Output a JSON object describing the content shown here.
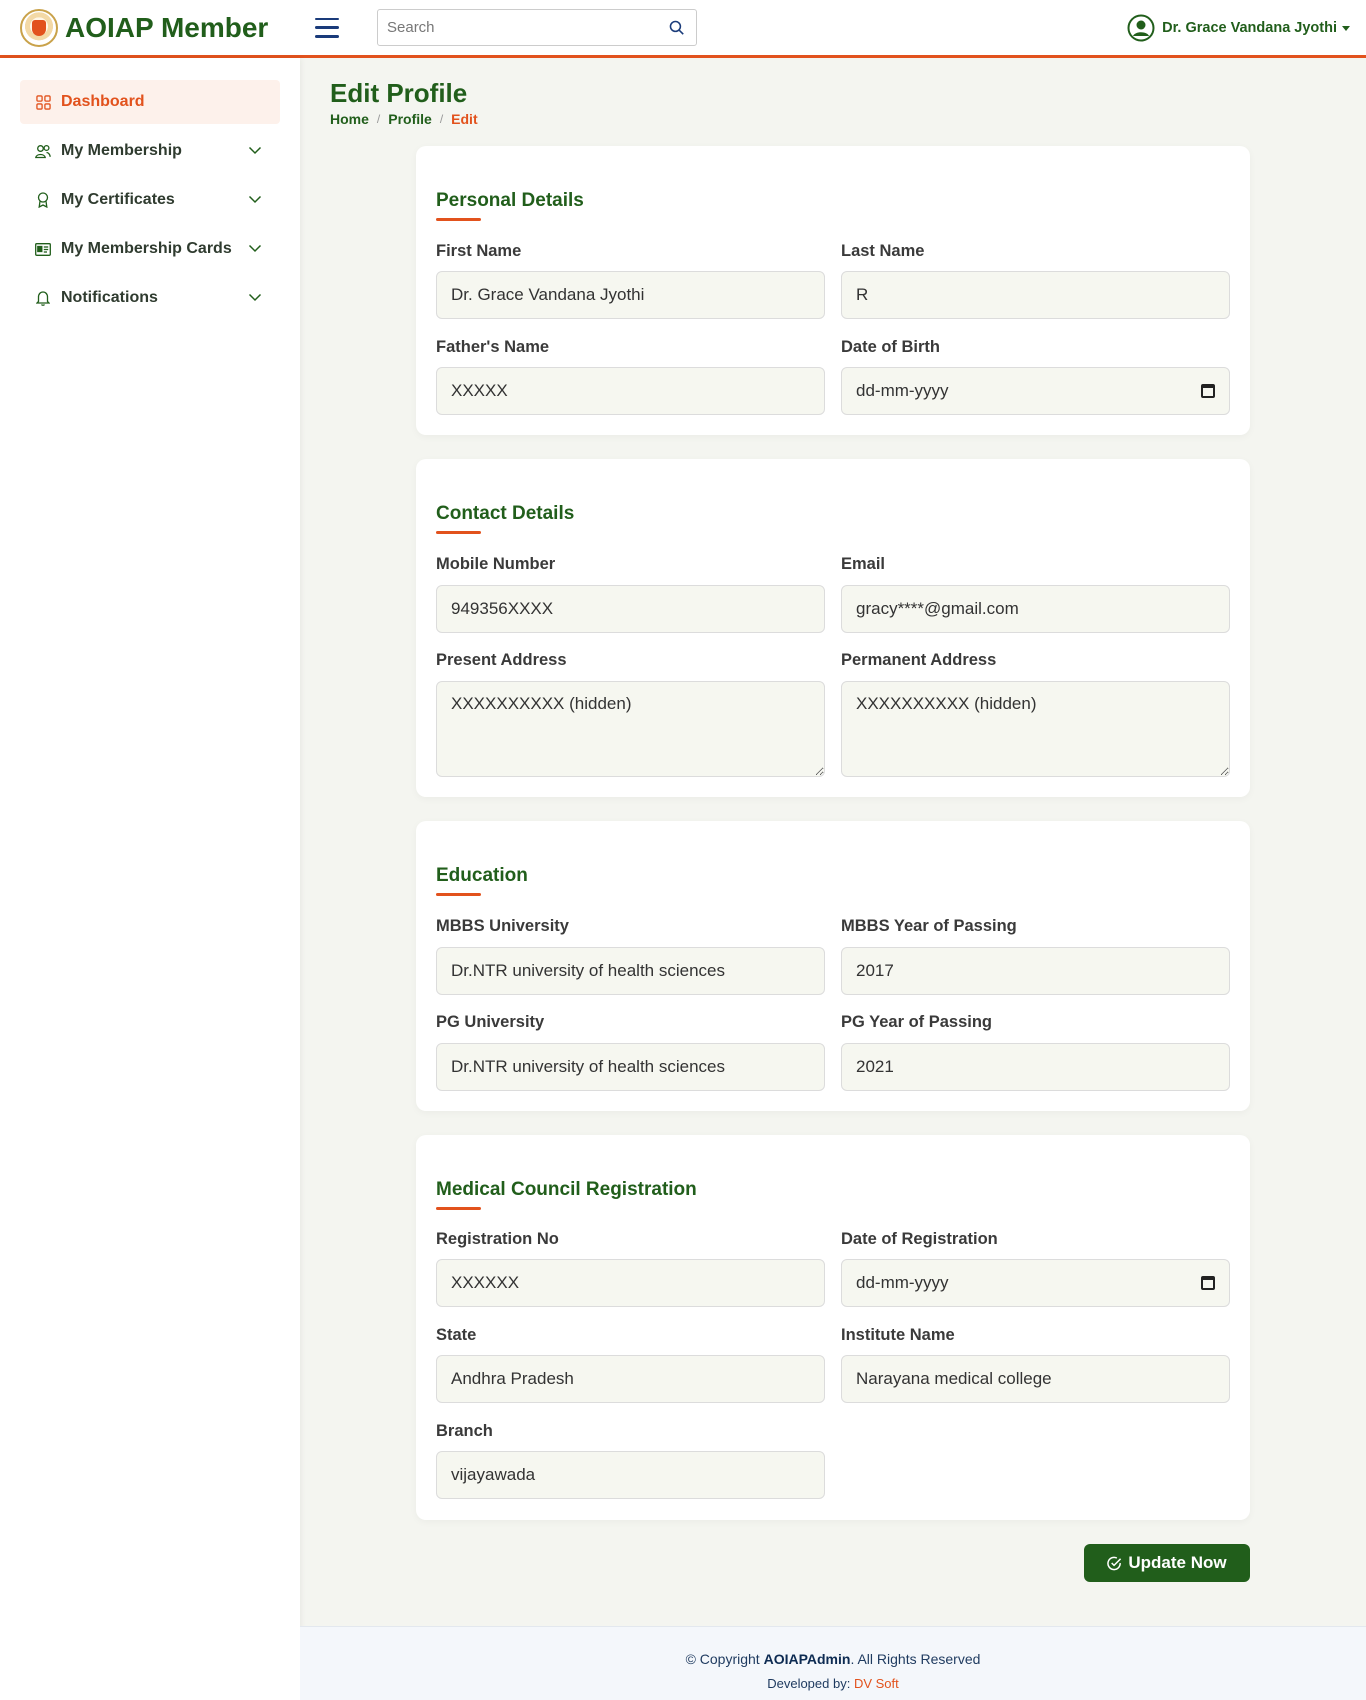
{
  "app": {
    "title": "AOIAP Member"
  },
  "search": {
    "placeholder": "Search"
  },
  "user": {
    "name": "Dr. Grace Vandana Jyothi"
  },
  "sidebar": {
    "items": [
      {
        "label": "Dashboard",
        "icon": "grid-icon",
        "active": true
      },
      {
        "label": "My Membership",
        "icon": "users-icon"
      },
      {
        "label": "My Certificates",
        "icon": "award-icon"
      },
      {
        "label": "My Membership Cards",
        "icon": "id-card-icon"
      },
      {
        "label": "Notifications",
        "icon": "bell-icon"
      }
    ]
  },
  "page": {
    "title": "Edit Profile"
  },
  "breadcrumb": {
    "home": "Home",
    "profile": "Profile",
    "current": "Edit"
  },
  "personal": {
    "title": "Personal Details",
    "first_name_label": "First Name",
    "first_name": "Dr. Grace Vandana Jyothi",
    "last_name_label": "Last Name",
    "last_name": "R",
    "father_label": "Father's Name",
    "father": "XXXXX",
    "dob_label": "Date of Birth",
    "dob": "dd-mm-yyyy"
  },
  "contact": {
    "title": "Contact Details",
    "mobile_label": "Mobile Number",
    "mobile": "949356XXXX",
    "email_label": "Email",
    "email": "gracy****@gmail.com",
    "present_label": "Present Address",
    "present": "XXXXXXXXXX (hidden)",
    "permanent_label": "Permanent Address",
    "permanent": "XXXXXXXXXX (hidden)"
  },
  "education": {
    "title": "Education",
    "mbbs_univ_label": "MBBS University",
    "mbbs_univ": "Dr.NTR university of health sciences",
    "mbbs_year_label": "MBBS Year of Passing",
    "mbbs_year": "2017",
    "pg_univ_label": "PG University",
    "pg_univ": "Dr.NTR university of health sciences",
    "pg_year_label": "PG Year of Passing",
    "pg_year": "2021"
  },
  "council": {
    "title": "Medical Council Registration",
    "reg_no_label": "Registration No",
    "reg_no": "XXXXXX",
    "reg_date_label": "Date of Registration",
    "reg_date": "dd-mm-yyyy",
    "state_label": "State",
    "state": "Andhra Pradesh",
    "institute_label": "Institute Name",
    "institute": "Narayana medical college",
    "branch_label": "Branch",
    "branch": "vijayawada"
  },
  "actions": {
    "update_label": "Update Now"
  },
  "footer": {
    "copyright_prefix": "© Copyright",
    "brand": "AOIAPAdmin",
    "copyright_suffix": ". All Rights Reserved",
    "developed_prefix": "Developed by:",
    "developer": "DV Soft"
  },
  "colors": {
    "brand_green": "#215e1b",
    "accent_orange": "#e2521d"
  }
}
